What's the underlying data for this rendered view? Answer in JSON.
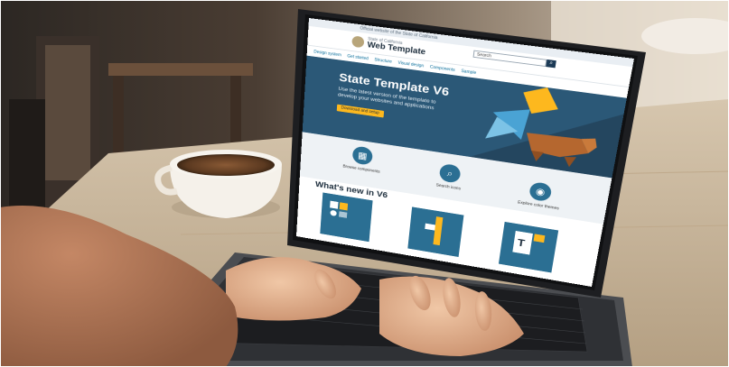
{
  "site": {
    "gov_banner": "Official website of the State of California",
    "brand_subtitle": "State of California",
    "brand_title": "Web Template",
    "nav": [
      "Design system",
      "Get started",
      "Structure",
      "Visual design",
      "Components",
      "Sample"
    ],
    "search_placeholder": "Search",
    "search_icon": "magnifier-icon"
  },
  "hero": {
    "title": "State Template V6",
    "text": "Use the latest version of the template to develop your websites and applications",
    "button": "Download and setup"
  },
  "features": [
    {
      "label": "Browse components",
      "icon": "grid-icon"
    },
    {
      "label": "Search icons",
      "icon": "search-icon"
    },
    {
      "label": "Explore color themes",
      "icon": "palette-icon"
    }
  ],
  "whats_new": {
    "title": "What's new in V6"
  },
  "colors": {
    "hero_blue": "#2b5877",
    "accent_gold": "#fdb81e",
    "icon_blue": "#2b6f93",
    "desk_wood": "#c9b69c"
  }
}
